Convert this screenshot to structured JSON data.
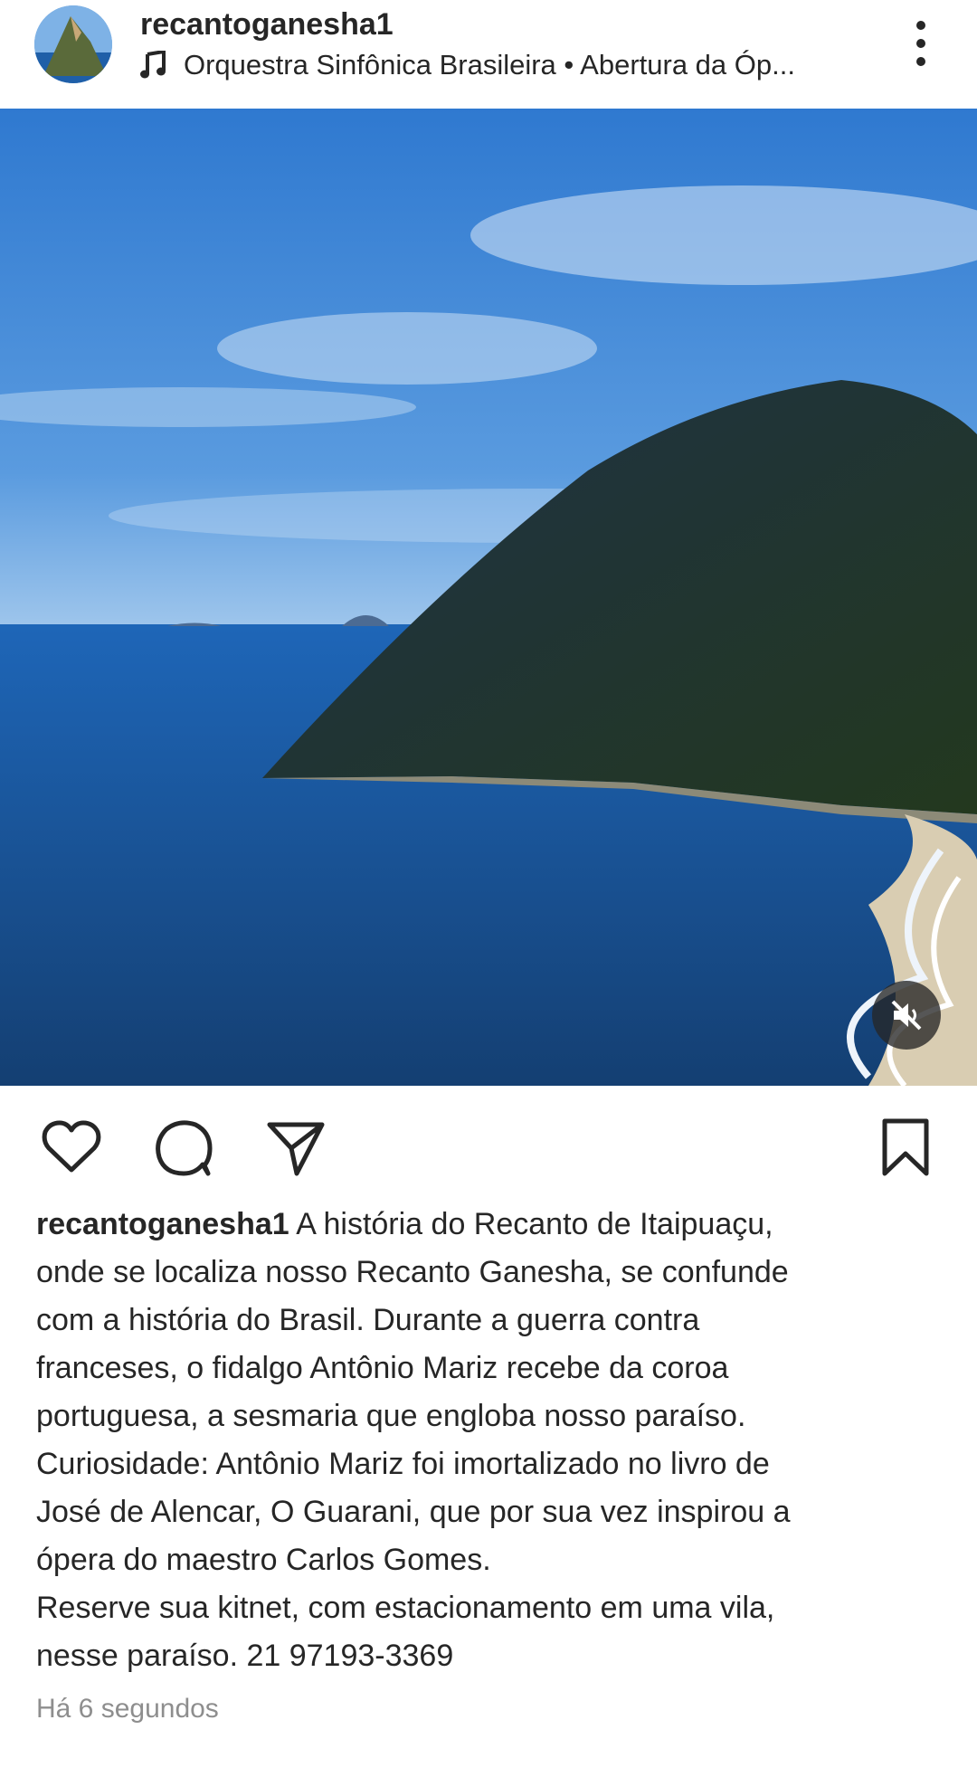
{
  "post": {
    "username": "recantoganesha1",
    "audio": "Orquestra Sinfônica Brasileira • Abertura da Óp...",
    "caption_username": "recantoganesha1",
    "caption_text": " A história do Recanto de Itaipuaçu,\nonde se localiza nosso Recanto Ganesha,  se confunde\ncom a história do Brasil.  Durante a guerra contra\nfranceses, o fidalgo Antônio Mariz recebe da coroa\nportuguesa,  a sesmaria que engloba nosso paraíso.\nCuriosidade: Antônio Mariz foi imortalizado no livro de\nJosé de Alencar, O Guarani,  que por sua vez inspirou a\nópera do maestro Carlos Gomes.\nReserve sua kitnet,  com estacionamento em uma vila,\nnesse paraíso. 21 97193-3369",
    "timestamp": "Há 6 segundos"
  },
  "icons": {
    "music": "music-note-icon",
    "more": "more-vertical-icon",
    "like": "heart-icon",
    "comment": "comment-icon",
    "share": "send-icon",
    "save": "bookmark-icon",
    "mute": "speaker-muted-icon"
  },
  "colors": {
    "text": "#262626",
    "muted_text": "#8e8e8e",
    "sky": "#3a7fd0",
    "sea": "#1d5a9c"
  }
}
